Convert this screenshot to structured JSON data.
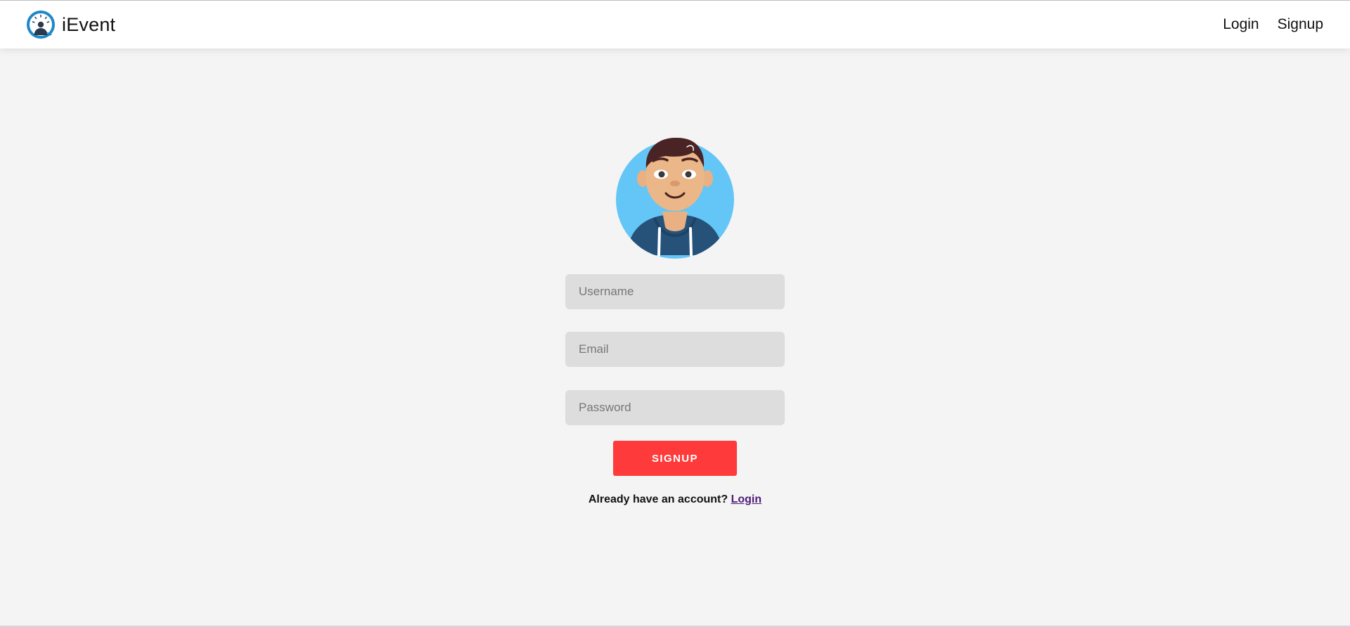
{
  "header": {
    "brand_name": "iEvent",
    "nav": {
      "login_label": "Login",
      "signup_label": "Signup"
    }
  },
  "form": {
    "avatar_icon": "user-avatar-icon",
    "username": {
      "placeholder": "Username",
      "value": ""
    },
    "email": {
      "placeholder": "Email",
      "value": ""
    },
    "password": {
      "placeholder": "Password",
      "value": ""
    },
    "submit_label": "SIGNUP",
    "account_prompt": "Already have an account?",
    "login_link": "Login"
  },
  "colors": {
    "page_background": "#f4f4f4",
    "header_background": "#ffffff",
    "input_background": "#dddddd",
    "primary_button": "#ff3a3a",
    "link": "#4b1d78",
    "logo_blue": "#1e88c8",
    "avatar_background": "#63c6f7"
  }
}
